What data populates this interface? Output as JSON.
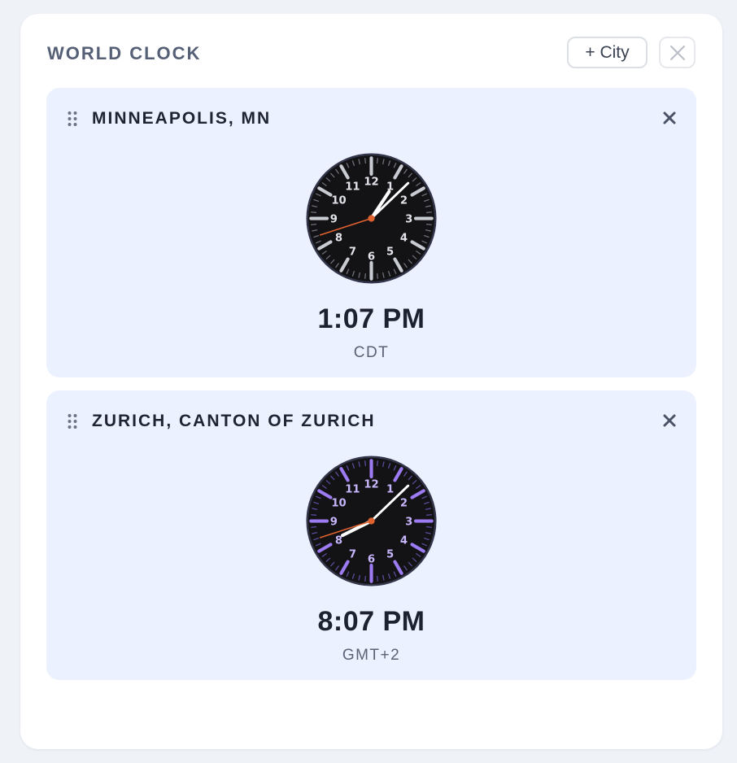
{
  "widget": {
    "title": "WORLD CLOCK",
    "add_city_label": "+ City",
    "close_icon": "close-icon"
  },
  "clocks": [
    {
      "city": "MINNEAPOLIS, MN",
      "time": "1:07 PM",
      "timezone": "CDT",
      "hour": 13,
      "minute": 7,
      "second": 42,
      "accent_color": "#c9cbd2"
    },
    {
      "city": "ZURICH, CANTON OF ZURICH",
      "time": "8:07 PM",
      "timezone": "GMT+2",
      "hour": 20,
      "minute": 7,
      "second": 42,
      "accent_color": "#9d7bf2"
    }
  ],
  "dial_numbers": [
    "12",
    "1",
    "2",
    "3",
    "4",
    "5",
    "6",
    "7",
    "8",
    "9",
    "10",
    "11"
  ],
  "colors": {
    "face": "#131316",
    "hands": "#ffffff",
    "second_hand": "#e0622f",
    "card_bg": "#ebf1fe"
  }
}
